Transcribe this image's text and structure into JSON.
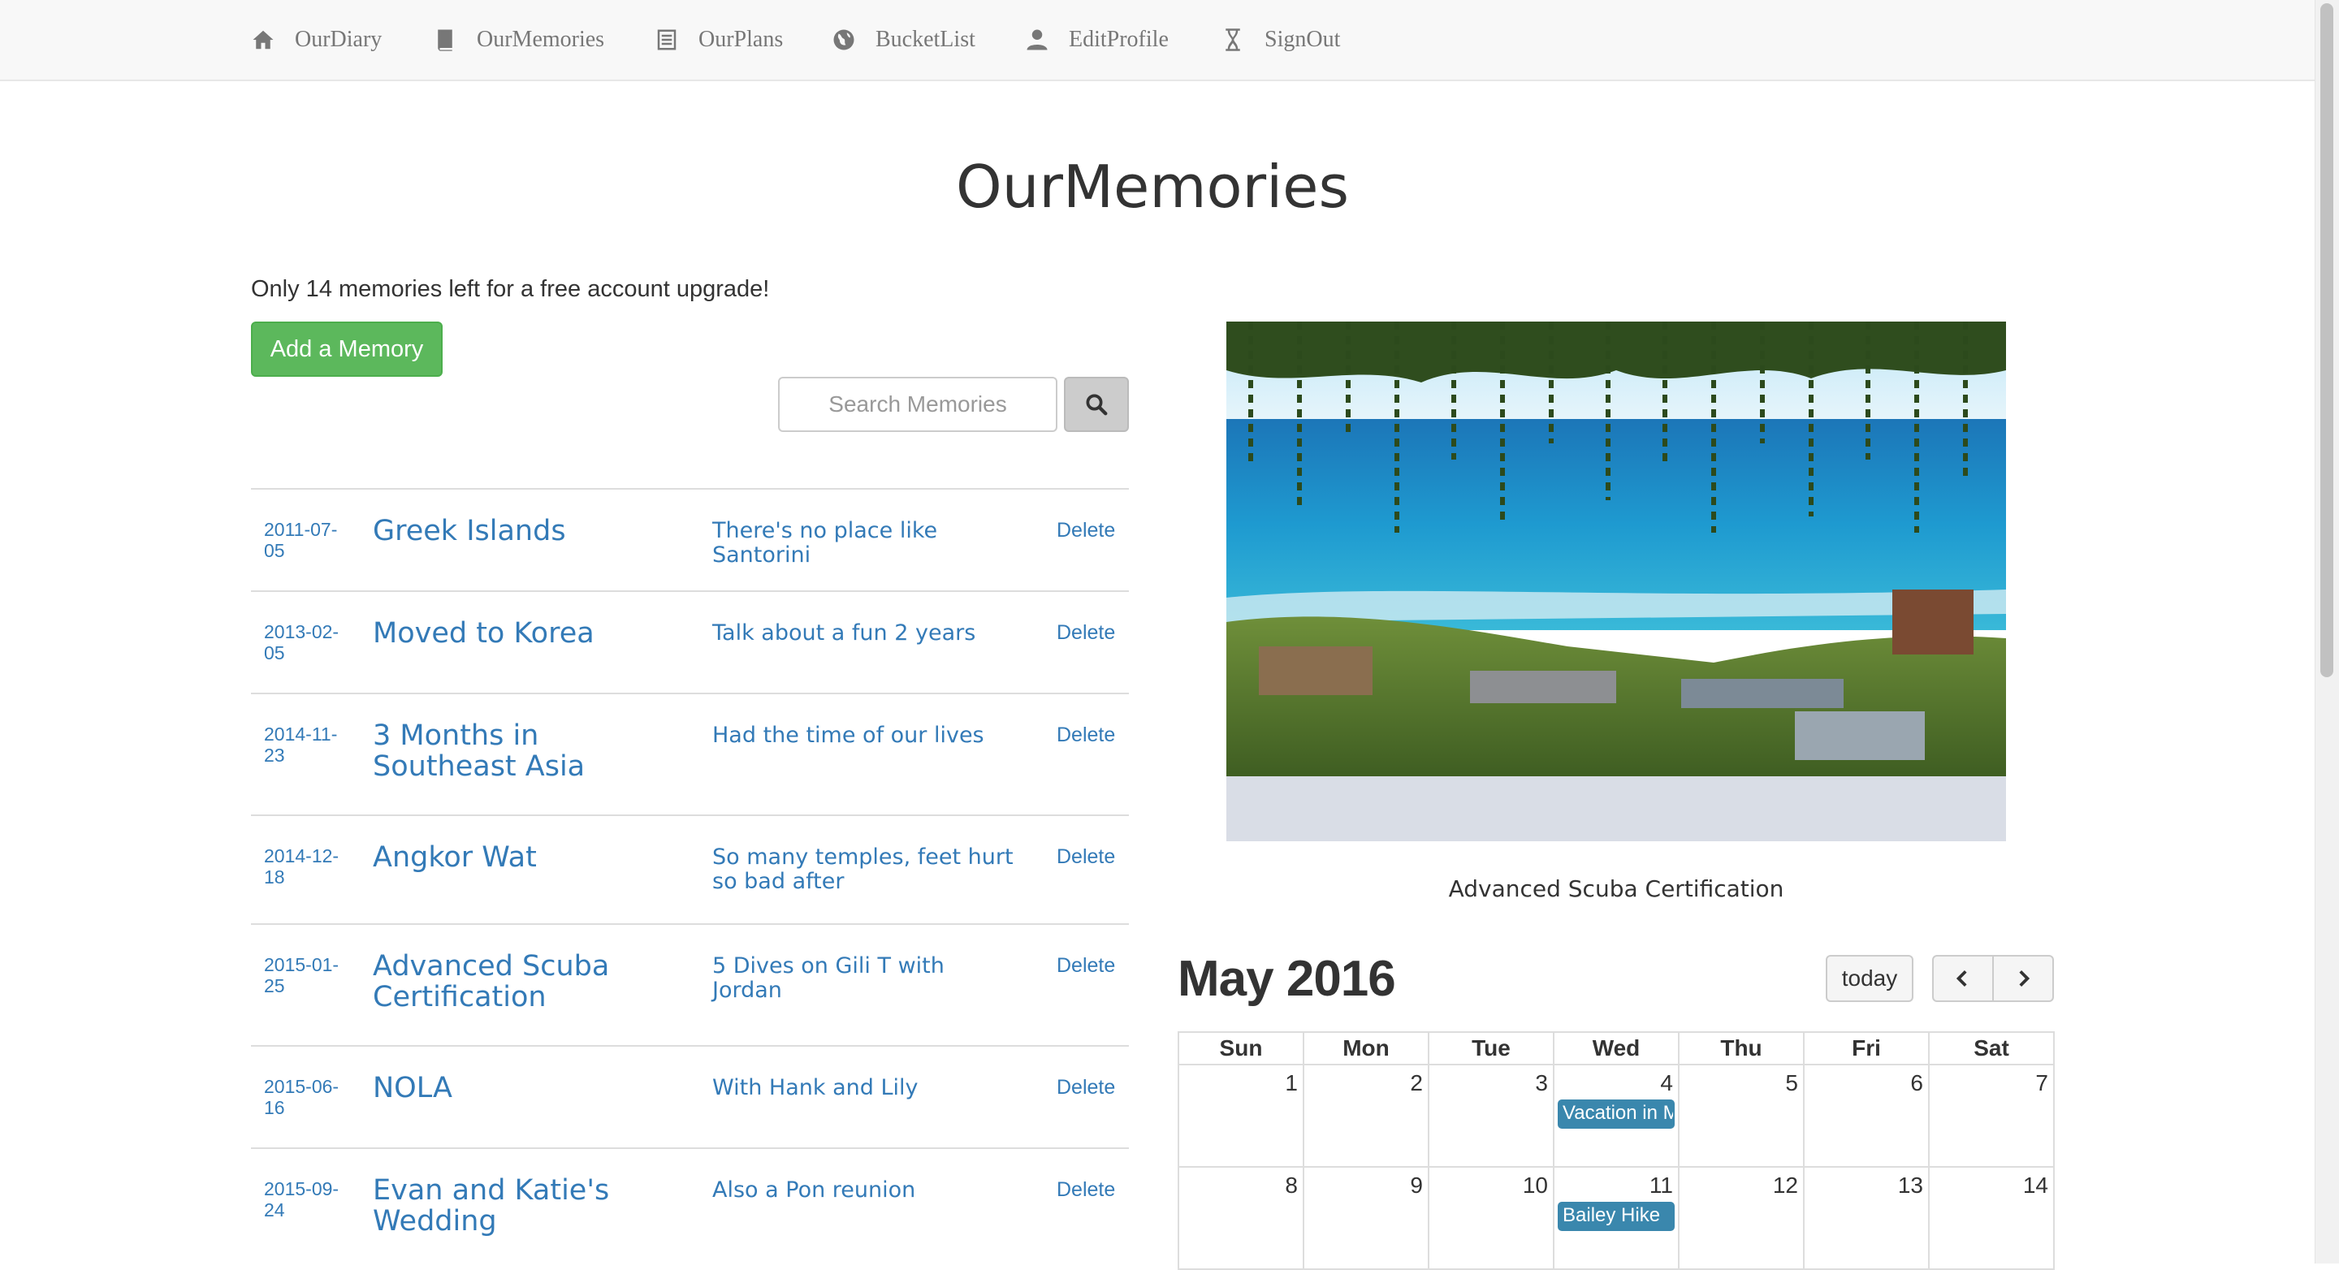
{
  "nav": {
    "items": [
      {
        "label": "OurDiary",
        "icon": "home-icon"
      },
      {
        "label": "OurMemories",
        "icon": "book-icon"
      },
      {
        "label": "OurPlans",
        "icon": "list-icon"
      },
      {
        "label": "BucketList",
        "icon": "globe-icon"
      },
      {
        "label": "EditProfile",
        "icon": "user-icon"
      },
      {
        "label": "SignOut",
        "icon": "hourglass-icon"
      }
    ]
  },
  "page": {
    "title": "OurMemories",
    "notice": "Only 14 memories left for a free account upgrade!",
    "add_button": "Add a Memory"
  },
  "search": {
    "placeholder": "Search Memories",
    "icon": "search-icon"
  },
  "memories": [
    {
      "date": "2011-07-05",
      "title": "Greek Islands",
      "description": "There's no place like Santorini",
      "delete_label": "Delete"
    },
    {
      "date": "2013-02-05",
      "title": "Moved to Korea",
      "description": "Talk about a fun 2 years",
      "delete_label": "Delete"
    },
    {
      "date": "2014-11-23",
      "title": "3 Months in Southeast Asia",
      "description": "Had the time of our lives",
      "delete_label": "Delete"
    },
    {
      "date": "2014-12-18",
      "title": "Angkor Wat",
      "description": "So many temples, feet hurt so bad after",
      "delete_label": "Delete"
    },
    {
      "date": "2015-01-25",
      "title": "Advanced Scuba Certification",
      "description": "5 Dives on Gili T with Jordan",
      "delete_label": "Delete"
    },
    {
      "date": "2015-06-16",
      "title": "NOLA",
      "description": "With Hank and Lily",
      "delete_label": "Delete"
    },
    {
      "date": "2015-09-24",
      "title": "Evan and Katie's Wedding",
      "description": "Also a Pon reunion",
      "delete_label": "Delete"
    }
  ],
  "featured": {
    "caption": "Advanced Scuba Certification"
  },
  "calendar": {
    "title": "May 2016",
    "today_label": "today",
    "prev_icon": "chevron-left-icon",
    "next_icon": "chevron-right-icon",
    "weekdays": [
      "Sun",
      "Mon",
      "Tue",
      "Wed",
      "Thu",
      "Fri",
      "Sat"
    ],
    "weeks": [
      [
        {
          "day": "1"
        },
        {
          "day": "2"
        },
        {
          "day": "3"
        },
        {
          "day": "4",
          "event": "Vacation in M"
        },
        {
          "day": "5"
        },
        {
          "day": "6"
        },
        {
          "day": "7"
        }
      ],
      [
        {
          "day": "8"
        },
        {
          "day": "9"
        },
        {
          "day": "10"
        },
        {
          "day": "11",
          "event": "Bailey Hike"
        },
        {
          "day": "12"
        },
        {
          "day": "13"
        },
        {
          "day": "14"
        }
      ]
    ],
    "event_color": "#3a87ad"
  },
  "colors": {
    "link": "#337ab7",
    "success": "#5cb85c",
    "navbar_bg": "#f8f8f8"
  }
}
